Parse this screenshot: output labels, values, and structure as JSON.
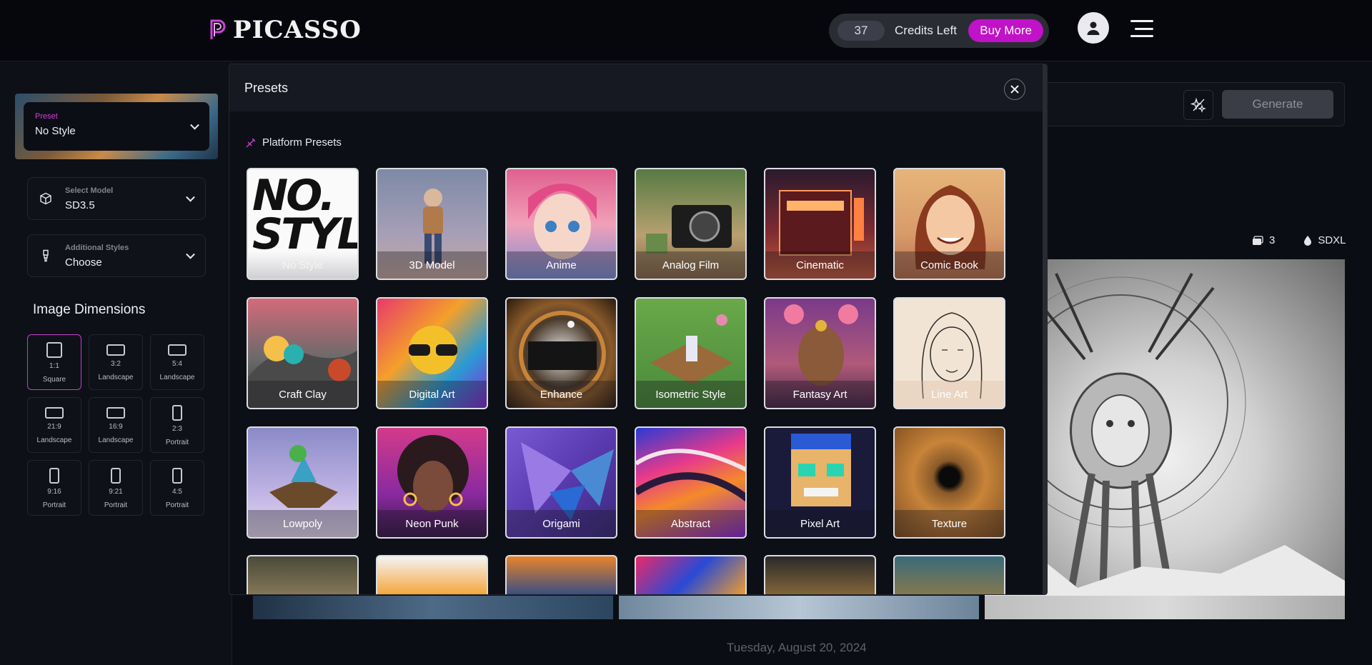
{
  "header": {
    "brand": "PICASSO",
    "credits_count": "37",
    "credits_label": "Credits Left",
    "buy_more": "Buy More"
  },
  "sidebar": {
    "preset_label": "Preset",
    "preset_value": "No Style",
    "model_label": "Select Model",
    "model_value": "SD3.5",
    "styles_label": "Additional Styles",
    "styles_value": "Choose",
    "dimensions_title": "Image Dimensions",
    "dimensions": [
      {
        "ratio": "1:1",
        "name": "Square",
        "active": true
      },
      {
        "ratio": "3:2",
        "name": "Landscape"
      },
      {
        "ratio": "5:4",
        "name": "Landscape"
      },
      {
        "ratio": "21:9",
        "name": "Landscape"
      },
      {
        "ratio": "16:9",
        "name": "Landscape"
      },
      {
        "ratio": "2:3",
        "name": "Portrait"
      },
      {
        "ratio": "9:16",
        "name": "Portrait"
      },
      {
        "ratio": "9:21",
        "name": "Portrait"
      },
      {
        "ratio": "4:5",
        "name": "Portrait"
      }
    ]
  },
  "main": {
    "generate": "Generate",
    "meta_count": "3",
    "meta_model": "SDXL",
    "date": "Tuesday, August 20, 2024"
  },
  "modal": {
    "title": "Presets",
    "section": "Platform Presets",
    "presets": [
      {
        "label": "No Style"
      },
      {
        "label": "3D Model"
      },
      {
        "label": "Anime"
      },
      {
        "label": "Analog Film"
      },
      {
        "label": "Cinematic"
      },
      {
        "label": "Comic Book"
      },
      {
        "label": "Craft Clay"
      },
      {
        "label": "Digital Art"
      },
      {
        "label": "Enhance"
      },
      {
        "label": "Isometric Style"
      },
      {
        "label": "Fantasy Art"
      },
      {
        "label": "Line Art"
      },
      {
        "label": "Lowpoly"
      },
      {
        "label": "Neon Punk"
      },
      {
        "label": "Origami"
      },
      {
        "label": "Abstract"
      },
      {
        "label": "Pixel Art"
      },
      {
        "label": "Texture"
      }
    ]
  },
  "colors": {
    "accent": "#c012c8",
    "background": "#0b0d14"
  }
}
